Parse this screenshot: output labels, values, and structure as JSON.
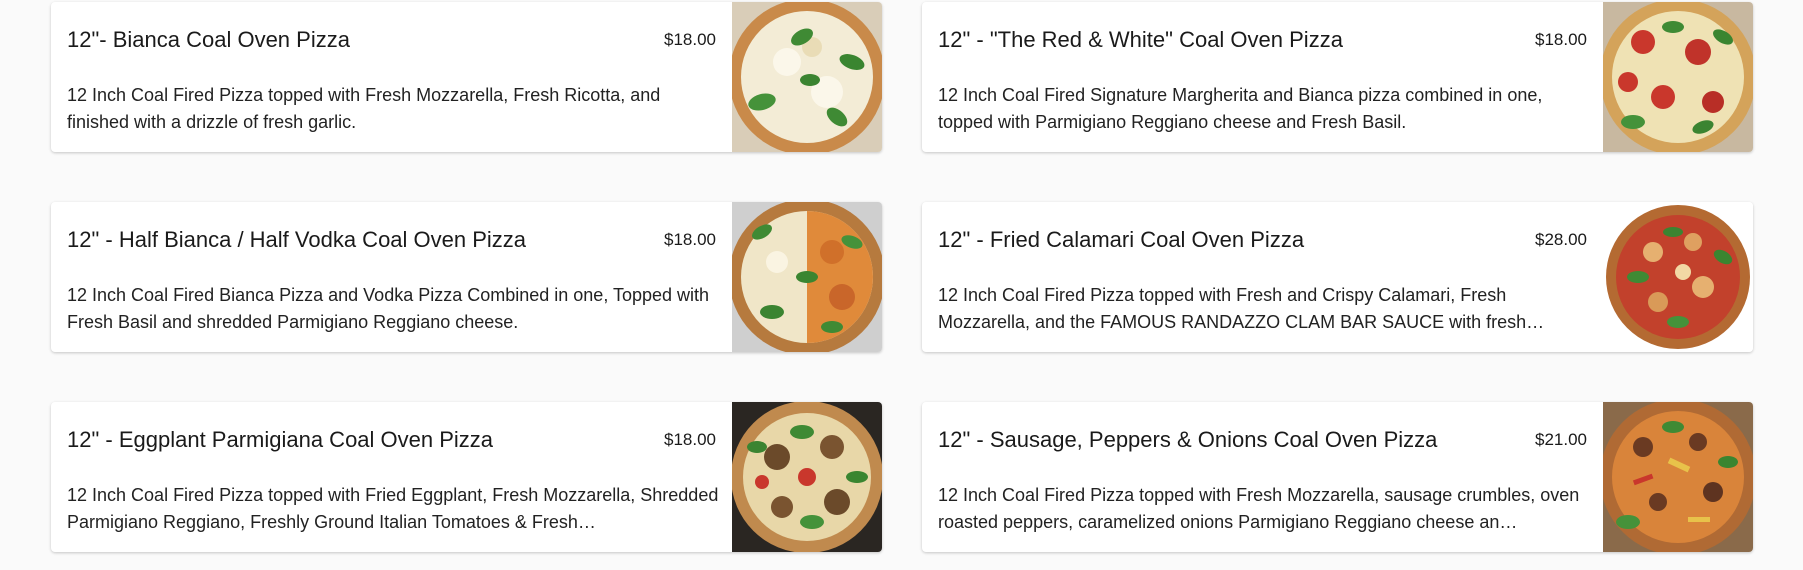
{
  "menu": {
    "items": [
      {
        "title": "12\"- Bianca Coal Oven Pizza",
        "price": "$18.00",
        "description": "12 Inch Coal Fired Pizza topped with Fresh Mozzarella, Fresh Ricotta, and finished with a drizzle of fresh garlic.",
        "image_name": "bianca-pizza-image"
      },
      {
        "title": "12\" - \"The Red & White\" Coal Oven Pizza",
        "price": "$18.00",
        "description": "12 Inch Coal Fired Signature Margherita and Bianca pizza combined in one, topped with Parmigiano Reggiano cheese and Fresh Basil.",
        "image_name": "red-and-white-pizza-image"
      },
      {
        "title": "12\" - Half Bianca / Half Vodka Coal Oven Pizza",
        "price": "$18.00",
        "description": "12 Inch Coal Fired Bianca Pizza and Vodka Pizza Combined in one, Topped with Fresh Basil and shredded Parmigiano Reggiano cheese.",
        "image_name": "half-bianca-half-vodka-pizza-image"
      },
      {
        "title": "12\" - Fried Calamari Coal Oven Pizza",
        "price": "$28.00",
        "description": "12 Inch Coal Fired Pizza topped with Fresh and Crispy Calamari, Fresh Mozzarella, and the FAMOUS RANDAZZO CLAM BAR SAUCE with fresh…",
        "image_name": "fried-calamari-pizza-image"
      },
      {
        "title": "12\" - Eggplant Parmigiana Coal Oven Pizza",
        "price": "$18.00",
        "description": "12 Inch Coal Fired Pizza topped with Fried Eggplant, Fresh Mozzarella, Shredded Parmigiano Reggiano, Freshly Ground Italian Tomatoes & Fresh…",
        "image_name": "eggplant-parmigiana-pizza-image"
      },
      {
        "title": "12\" - Sausage, Peppers & Onions Coal Oven Pizza",
        "price": "$21.00",
        "description": "12 Inch Coal Fired Pizza topped with Fresh Mozzarella, sausage crumbles, oven roasted peppers, caramelized onions Parmigiano Reggiano cheese an…",
        "image_name": "sausage-peppers-onions-pizza-image"
      }
    ]
  },
  "colors": {
    "page_background": "#fafafa",
    "card_background": "#ffffff",
    "text": "#1a1a1a"
  }
}
